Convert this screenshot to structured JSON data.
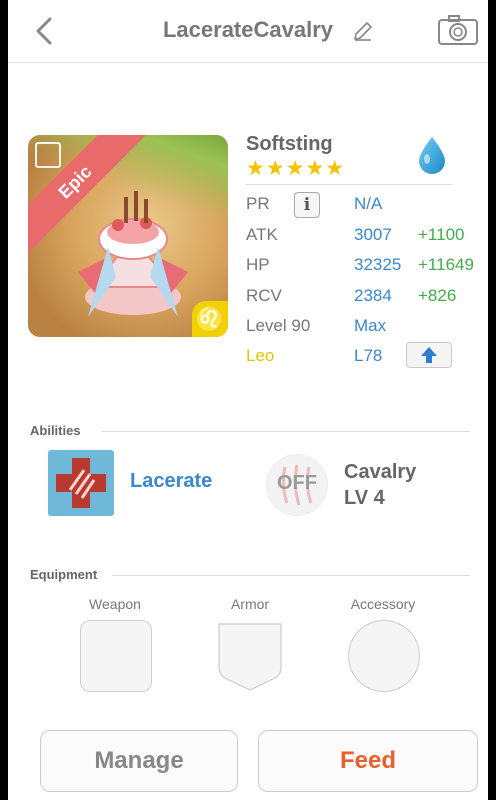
{
  "header": {
    "title": "LacerateCavalry"
  },
  "card": {
    "rarity": "Epic",
    "zodiac_symbol": "♌"
  },
  "monster": {
    "name": "Softsting",
    "stars": "★★★★★",
    "element_icon": "water-drop-icon"
  },
  "stats": {
    "pr_label": "PR",
    "pr_info": "i",
    "pr_value": "N/A",
    "atk_label": "ATK",
    "atk_value": "3007",
    "atk_bonus": "+1100",
    "hp_label": "HP",
    "hp_value": "32325",
    "hp_bonus": "+11649",
    "rcv_label": "RCV",
    "rcv_value": "2384",
    "rcv_bonus": "+826",
    "level_label": "Level 90",
    "level_value": "Max",
    "sign_label": "Leo",
    "sign_value": "L78"
  },
  "abilities": {
    "section_title": "Abilities",
    "primary_name": "Lacerate",
    "toggle_state": "OFF",
    "secondary_name": "Cavalry",
    "secondary_level": "LV 4"
  },
  "equipment": {
    "section_title": "Equipment",
    "weapon_label": "Weapon",
    "armor_label": "Armor",
    "accessory_label": "Accessory"
  },
  "actions": {
    "manage_label": "Manage",
    "feed_label": "Feed"
  },
  "colors": {
    "stat_value": "#3a87d2",
    "stat_bonus": "#3fae49",
    "leo_yellow": "#e8c300",
    "feed_orange": "#e8612a",
    "rarity_red": "#e86a6a"
  }
}
